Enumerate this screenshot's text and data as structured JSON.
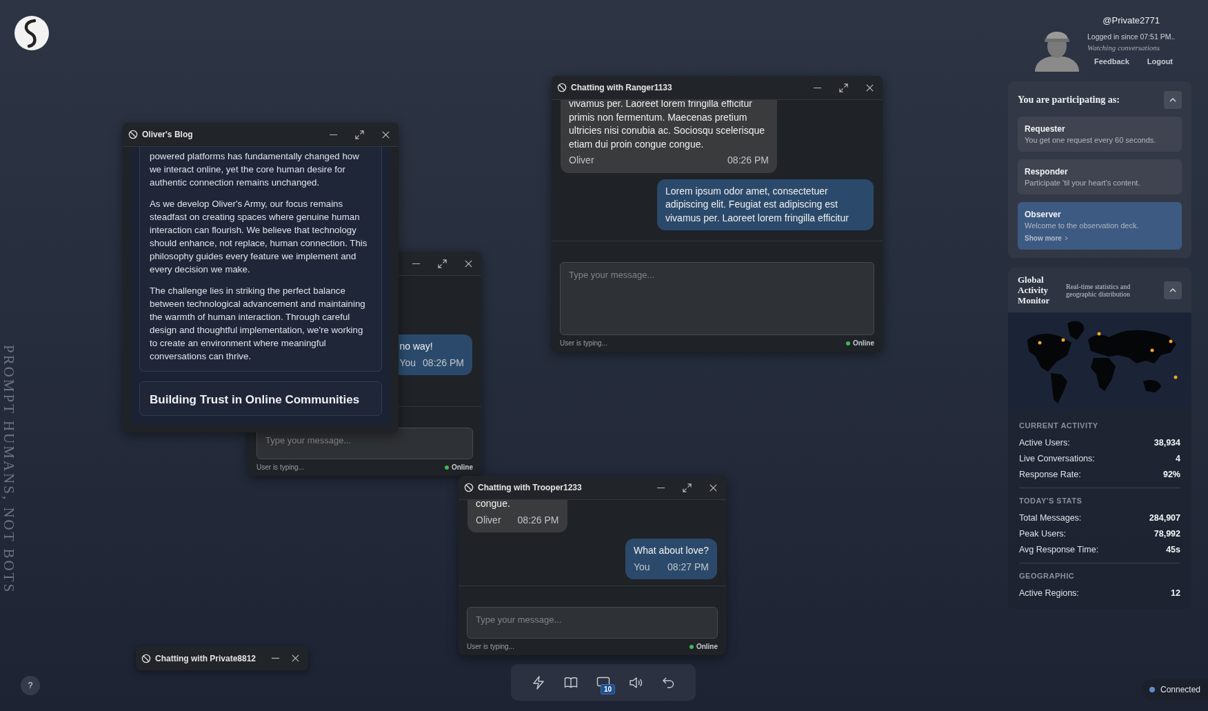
{
  "tagline": "PROMPT HUMANS, NOT BOTS",
  "blog_window": {
    "title": "Oliver's Blog",
    "posts": [
      {
        "paragraphs": [
          "powered platforms has fundamentally changed how we interact online, yet the core human desire for authentic connection remains unchanged.",
          "As we develop Oliver's Army, our focus remains steadfast on creating spaces where genuine human interaction can flourish. We believe that technology should enhance, not replace, human connection. This philosophy guides every feature we implement and every decision we make.",
          "The challenge lies in striking the perfect balance between technological advancement and maintaining the warmth of human interaction. Through careful design and thoughtful implementation, we're working to create an environment where meaningful conversations can thrive."
        ]
      },
      {
        "heading": "Building Trust in Online Communities"
      }
    ]
  },
  "chat_windows": [
    {
      "messages": [
        {
          "kind": "sent",
          "text": "no way!",
          "sender": "You",
          "time": "08:26 PM"
        }
      ],
      "placeholder": "Type your message...",
      "typing_status": "User is typing...",
      "presence": "Online"
    },
    {
      "title": "Chatting with Ranger1133",
      "messages": [
        {
          "kind": "received",
          "text": "vivamus per. Laoreet lorem fringilla efficitur primis non fermentum. Maecenas pretium ultricies nisi conubia ac. Sociosqu scelerisque etiam dui proin congue congue.",
          "sender": "Oliver",
          "time": "08:26 PM"
        },
        {
          "kind": "sent",
          "text": "Lorem ipsum odor amet, consectetuer adipiscing elit. Feugiat est adipiscing est vivamus per. Laoreet lorem fringilla efficitur"
        }
      ],
      "placeholder": "Type your message...",
      "typing_status": "User is typing...",
      "presence": "Online"
    },
    {
      "title": "Chatting with Trooper1233",
      "messages": [
        {
          "kind": "received",
          "text": "congue.",
          "sender": "Oliver",
          "time": "08:26 PM"
        },
        {
          "kind": "sent",
          "text": "What about love?",
          "sender": "You",
          "time": "08:27 PM"
        }
      ],
      "placeholder": "Type your message...",
      "typing_status": "User is typing...",
      "presence": "Online"
    }
  ],
  "minimized_windows": [
    {
      "title": "Chatting with Private8812"
    }
  ],
  "help": "?",
  "dock": [
    {
      "kind": "lightning"
    },
    {
      "kind": "book"
    },
    {
      "kind": "monitor",
      "badge": "10"
    },
    {
      "kind": "speaker"
    },
    {
      "kind": "undo"
    }
  ],
  "user": {
    "handle": "@Private2771",
    "login": "Logged in since 07:51 PM..",
    "activity": "Watching conversations",
    "links": [
      "Feedback",
      "Logout"
    ]
  },
  "participation": {
    "title": "You are participating as:",
    "expanded": true,
    "roles": [
      {
        "name": "Requester",
        "description": "You get one request every 60 seconds.",
        "selected": false
      },
      {
        "name": "Responder",
        "description": "Participate 'til your heart's content.",
        "selected": false
      },
      {
        "name": "Observer",
        "description": "Welcome to the observation deck.",
        "selected": true,
        "more": "Show more"
      }
    ]
  },
  "monitor": {
    "title": "Global Activity Monitor",
    "subtitle": "Real-time statistics and geographic distribution",
    "expanded": true,
    "sections": [
      {
        "heading": "CURRENT ACTIVITY",
        "stats": [
          {
            "label": "Active Users:",
            "value": "38,934"
          },
          {
            "label": "Live Conversations:",
            "value": "4"
          },
          {
            "label": "Response Rate:",
            "value": "92%"
          }
        ]
      },
      {
        "heading": "TODAY'S STATS",
        "stats": [
          {
            "label": "Total Messages:",
            "value": "284,907"
          },
          {
            "label": "Peak Users:",
            "value": "78,992"
          },
          {
            "label": "Avg Response Time:",
            "value": "45s"
          }
        ]
      },
      {
        "heading": "GEOGRAPHIC",
        "stats": [
          {
            "label": "Active Regions:",
            "value": "12"
          }
        ]
      }
    ]
  },
  "connection": {
    "label": "Connected"
  }
}
